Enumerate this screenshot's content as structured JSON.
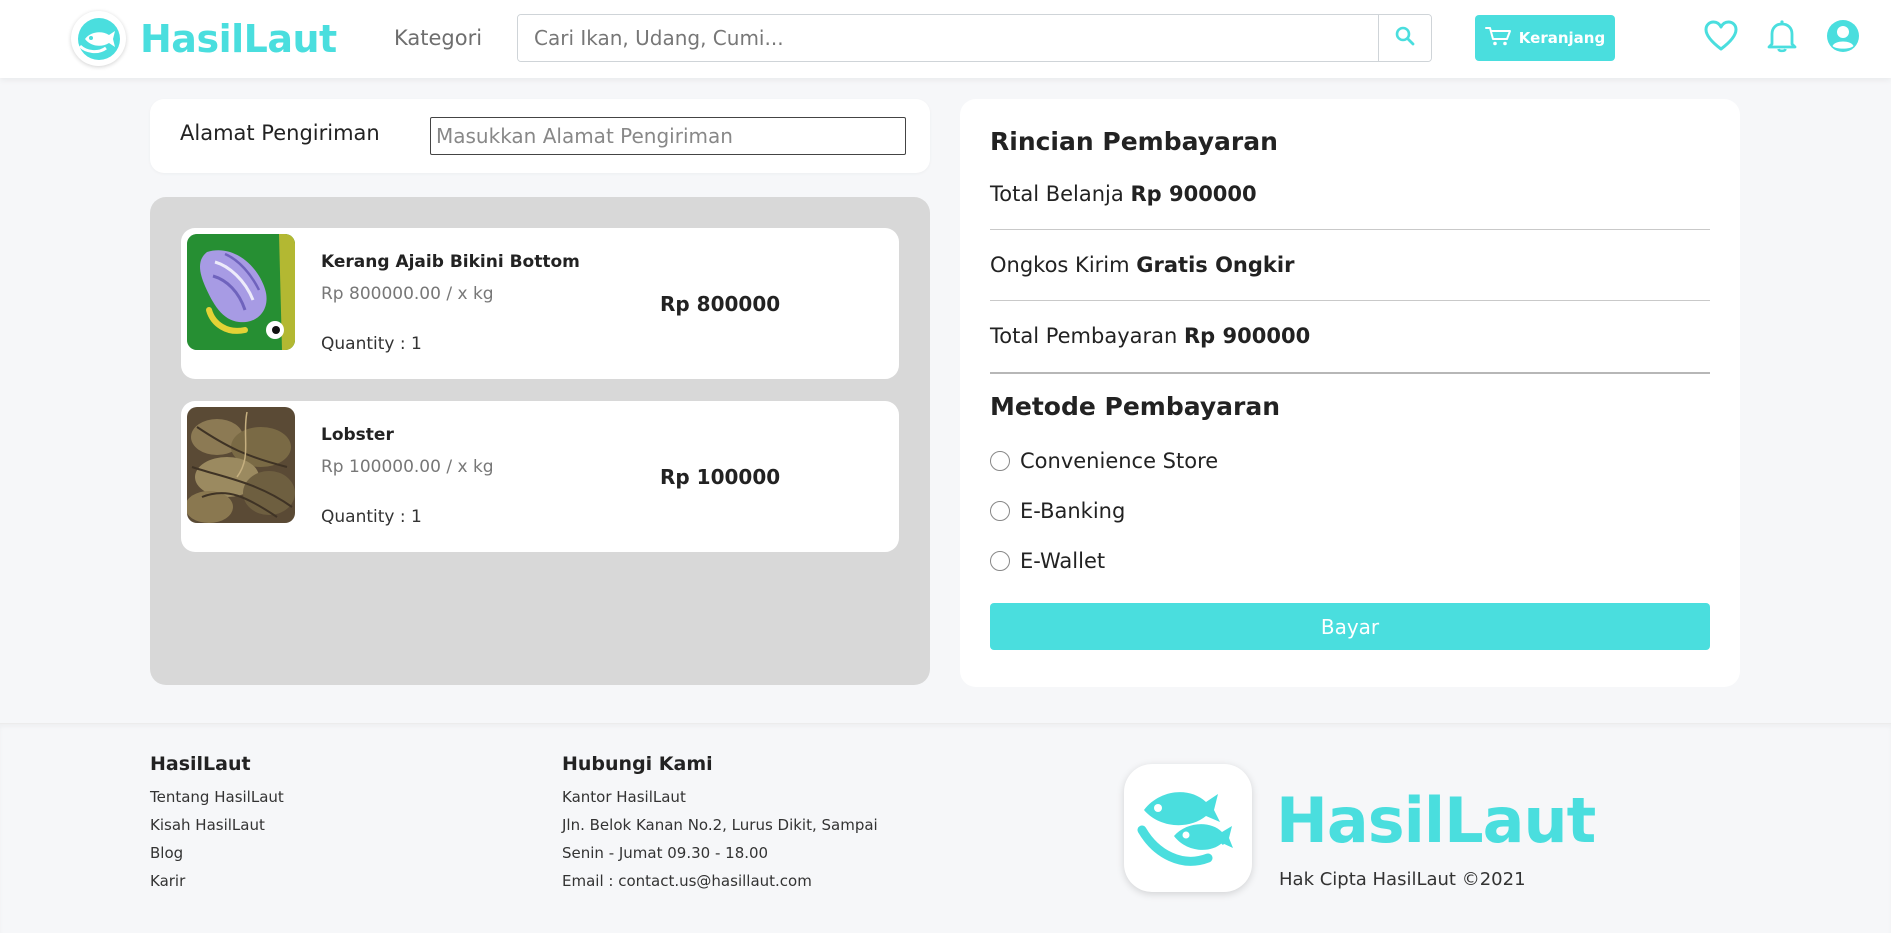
{
  "navbar": {
    "brand": "HasilLaut",
    "kategori": "Kategori",
    "search_placeholder": "Cari Ikan, Udang, Cumi...",
    "cart_label": "Keranjang"
  },
  "address": {
    "label": "Alamat Pengiriman",
    "placeholder": "Masukkan Alamat Pengiriman"
  },
  "items": [
    {
      "name": "Kerang Ajaib Bikini Bottom",
      "unit_price": "Rp 800000.00 / x kg",
      "quantity": "Quantity : 1",
      "total": "Rp 800000"
    },
    {
      "name": "Lobster",
      "unit_price": "Rp 100000.00 / x kg",
      "quantity": "Quantity : 1",
      "total": "Rp 100000"
    }
  ],
  "payment": {
    "title": "Rincian Pembayaran",
    "total_belanja_label": "Total Belanja",
    "total_belanja_value": "Rp 900000",
    "ongkir_label": "Ongkos Kirim",
    "ongkir_value": "Gratis Ongkir",
    "total_bayar_label": "Total Pembayaran",
    "total_bayar_value": "Rp 900000",
    "method_title": "Metode Pembayaran",
    "methods": [
      "Convenience Store",
      "E-Banking",
      "E-Wallet"
    ],
    "pay_button": "Bayar"
  },
  "footer": {
    "col1_title": "HasilLaut",
    "col1_links": [
      "Tentang HasilLaut",
      "Kisah HasilLaut",
      "Blog",
      "Karir"
    ],
    "col2_title": "Hubungi Kami",
    "col2_lines": [
      "Kantor HasilLaut",
      "Jln. Belok Kanan No.2, Lurus Dikit, Sampai",
      "Senin - Jumat 09.30 - 18.00",
      "Email : contact.us@hasillaut.com"
    ],
    "brand": "HasilLaut",
    "copyright": "Hak Cipta HasilLaut ©2021"
  },
  "colors": {
    "accent": "#4adede",
    "panel_gray": "#d8d8d8",
    "background": "#f6f7f9"
  },
  "icons": [
    "fish-logo-icon",
    "search-icon",
    "cart-icon",
    "heart-icon",
    "bell-icon",
    "user-icon",
    "shell-image",
    "lobster-image"
  ]
}
